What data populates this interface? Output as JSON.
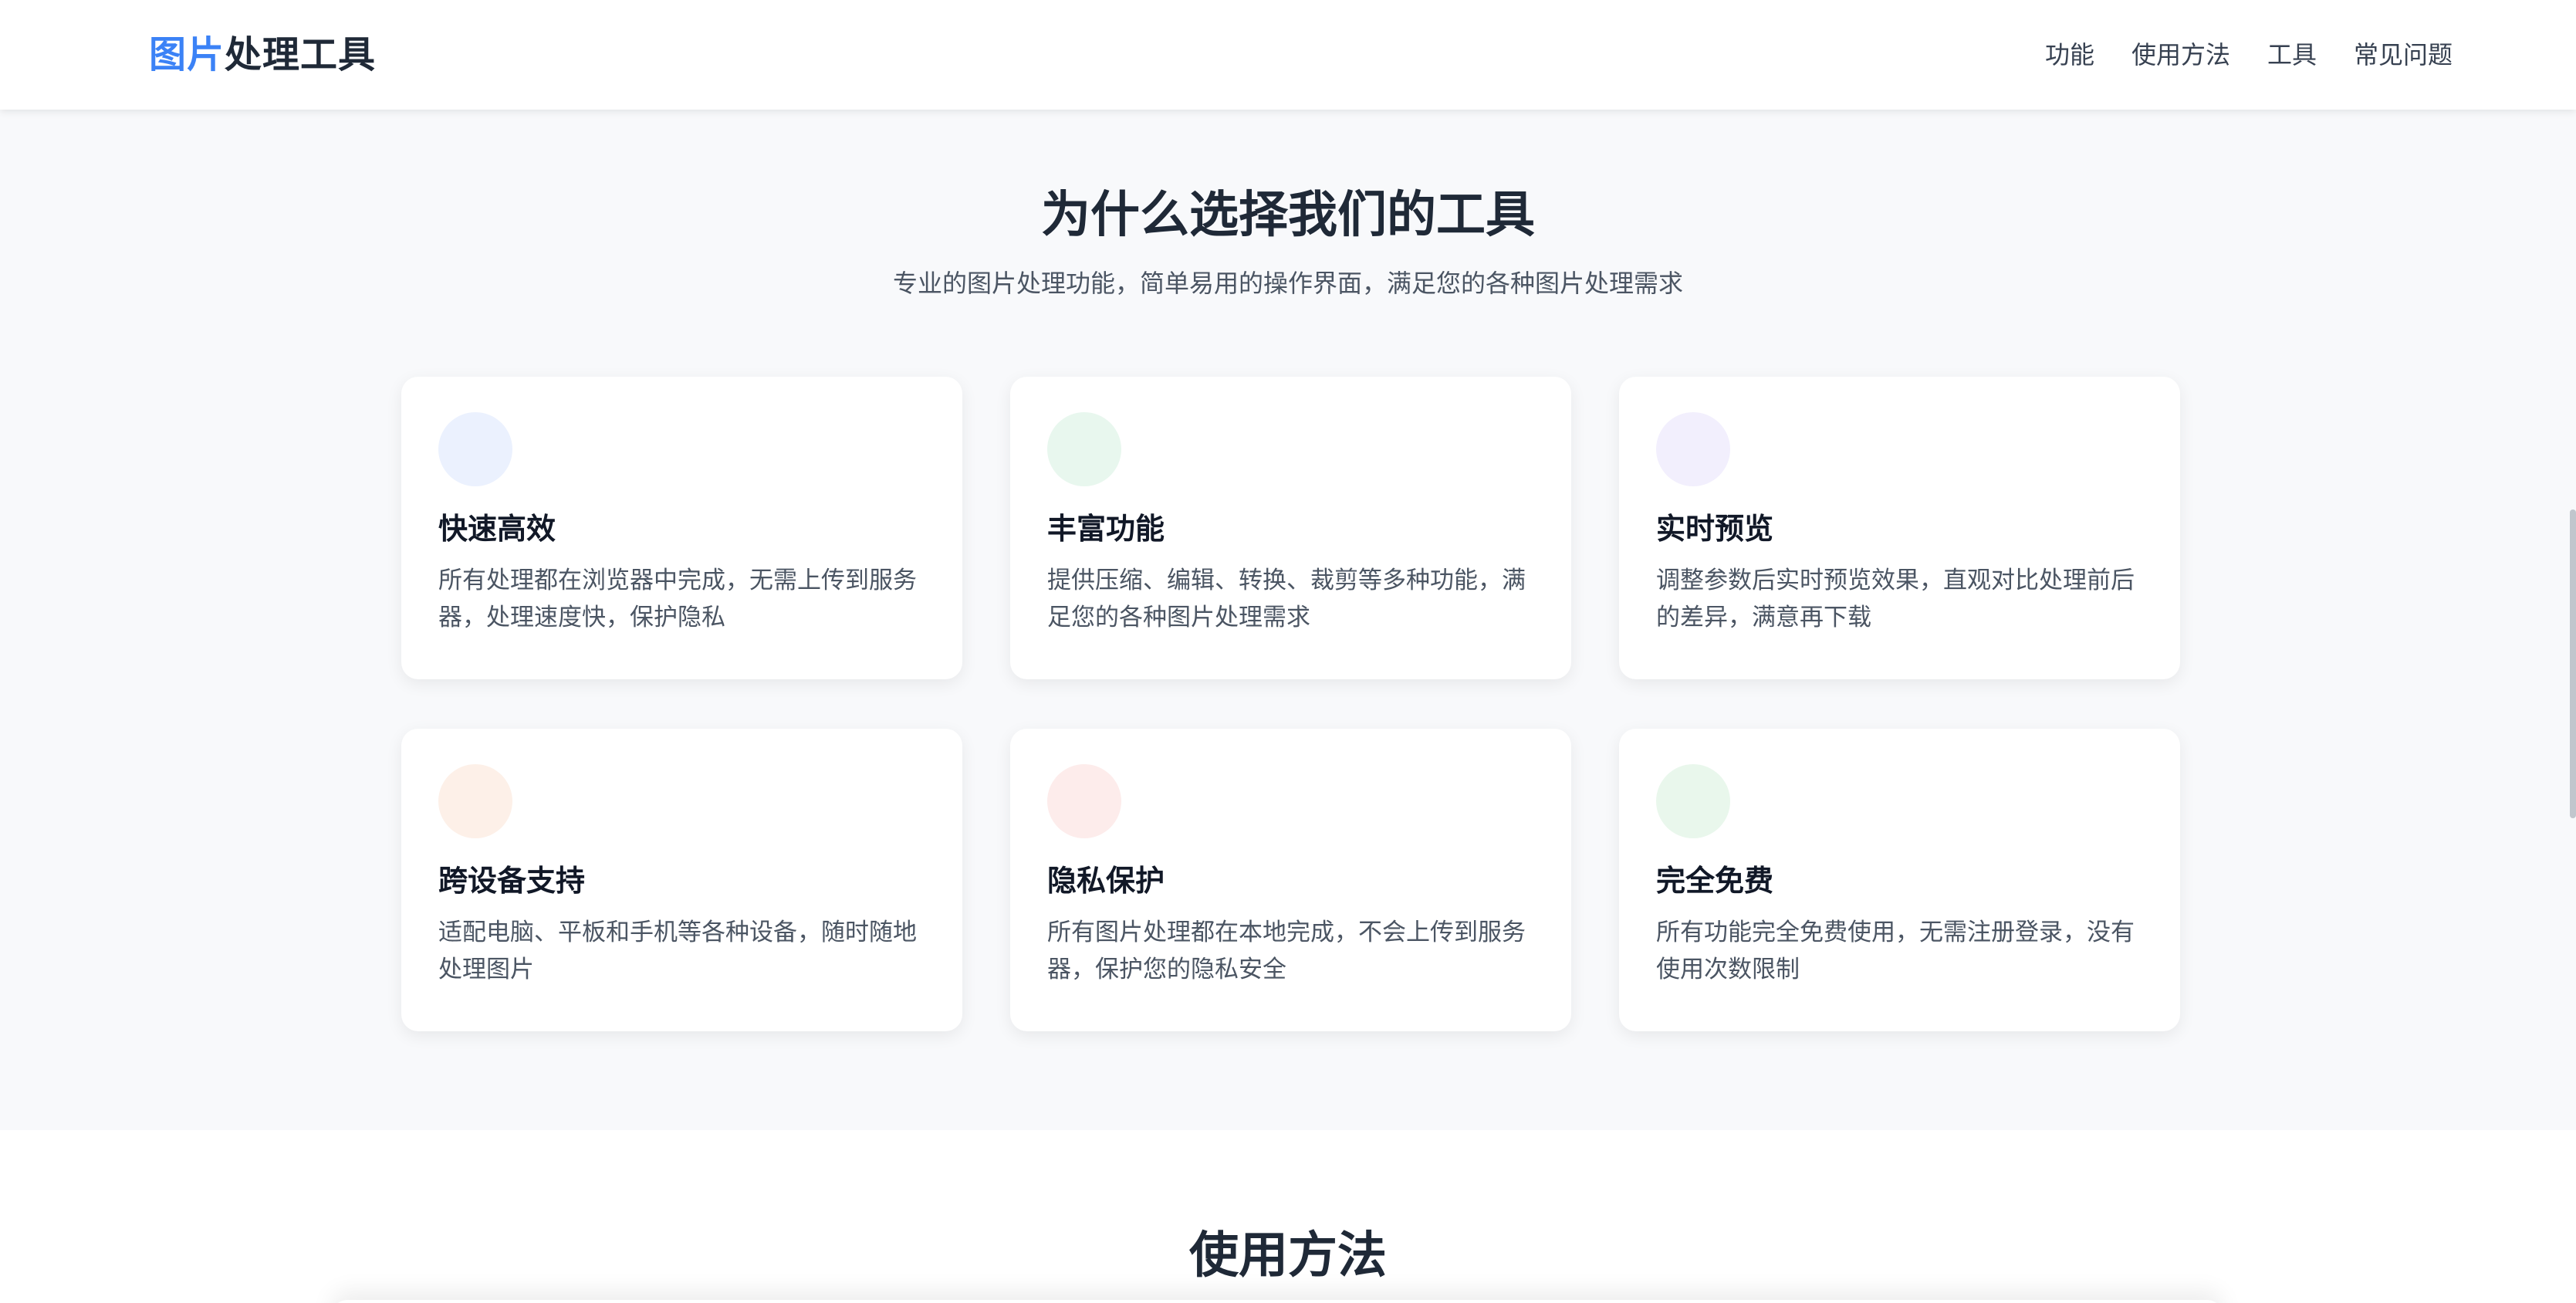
{
  "header": {
    "logo_accent": "图片",
    "logo_rest": "处理工具",
    "nav": [
      "功能",
      "使用方法",
      "工具",
      "常见问题"
    ]
  },
  "features": {
    "title": "为什么选择我们的工具",
    "subtitle": "专业的图片处理功能，简单易用的操作界面，满足您的各种图片处理需求",
    "cards": [
      {
        "title": "快速高效",
        "desc": "所有处理都在浏览器中完成，无需上传到服务器，处理速度快，保护隐私",
        "icon": "speed-icon",
        "icon_bg": "#ebf1fe"
      },
      {
        "title": "丰富功能",
        "desc": "提供压缩、编辑、转换、裁剪等多种功能，满足您的各种图片处理需求",
        "icon": "features-icon",
        "icon_bg": "#e8f7ee"
      },
      {
        "title": "实时预览",
        "desc": "调整参数后实时预览效果，直观对比处理前后的差异，满意再下载",
        "icon": "preview-icon",
        "icon_bg": "#f2effd"
      },
      {
        "title": "跨设备支持",
        "desc": "适配电脑、平板和手机等各种设备，随时随地处理图片",
        "icon": "devices-icon",
        "icon_bg": "#fdf0e8"
      },
      {
        "title": "隐私保护",
        "desc": "所有图片处理都在本地完成，不会上传到服务器，保护您的隐私安全",
        "icon": "privacy-icon",
        "icon_bg": "#fdeceb"
      },
      {
        "title": "完全免费",
        "desc": "所有功能完全免费使用，无需注册登录，没有使用次数限制",
        "icon": "free-icon",
        "icon_bg": "#e9f7ec"
      }
    ]
  },
  "usage": {
    "title": "使用方法"
  }
}
